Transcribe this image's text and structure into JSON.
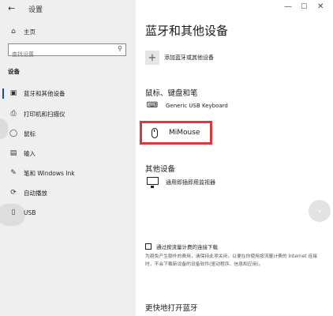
{
  "window": {
    "title": "设置",
    "back_icon": "←",
    "minimize_icon": "—",
    "maximize_icon": "☐",
    "close_icon": "✕"
  },
  "sidebar": {
    "home": {
      "label": "主页",
      "icon": "⌂"
    },
    "search": {
      "placeholder": "查找设置",
      "value": "",
      "icon": "⚲"
    },
    "section": "设备",
    "items": [
      {
        "label": "蓝牙和其他设备",
        "icon": "▣",
        "active": true
      },
      {
        "label": "打印机和扫描仪",
        "icon": "⎙",
        "active": false
      },
      {
        "label": "鼠标",
        "icon": "◯",
        "active": false
      },
      {
        "label": "输入",
        "icon": "▤",
        "active": false
      },
      {
        "label": "笔和 Windows Ink",
        "icon": "✎",
        "active": false
      },
      {
        "label": "自动播放",
        "icon": "⟳",
        "active": false
      },
      {
        "label": "USB",
        "icon": "▯",
        "active": false
      }
    ]
  },
  "main": {
    "title": "蓝牙和其他设备",
    "add_device": {
      "icon": "+",
      "label": "添加蓝牙或其他设备"
    },
    "groups": [
      {
        "title": "鼠标、键盘和笔",
        "devices": [
          {
            "name": "Generic USB Keyboard",
            "icon": "keyboard-icon"
          },
          {
            "name": "MiMouse",
            "icon": "mouse-icon",
            "highlighted": true
          }
        ]
      },
      {
        "title": "其他设备",
        "devices": [
          {
            "name": "通用即插即用监视器",
            "icon": "monitor-icon"
          }
        ]
      }
    ],
    "metered": {
      "label": "通过按流量计费的连接下载",
      "checked": false,
      "help": "为避免产生额外的费用，请保持此项关闭，以便在你使用按流量计费的 Internet 连接时，不会下载新设备的设备软件(驱动程序、信息和应用)。"
    },
    "bottom_title": "更快地打开蓝牙",
    "scroll_right_icon": "›"
  },
  "colors": {
    "sidebar_bg": "#efefef",
    "highlight_border": "#d83a3a",
    "active_indicator": "#1a4fa0"
  }
}
